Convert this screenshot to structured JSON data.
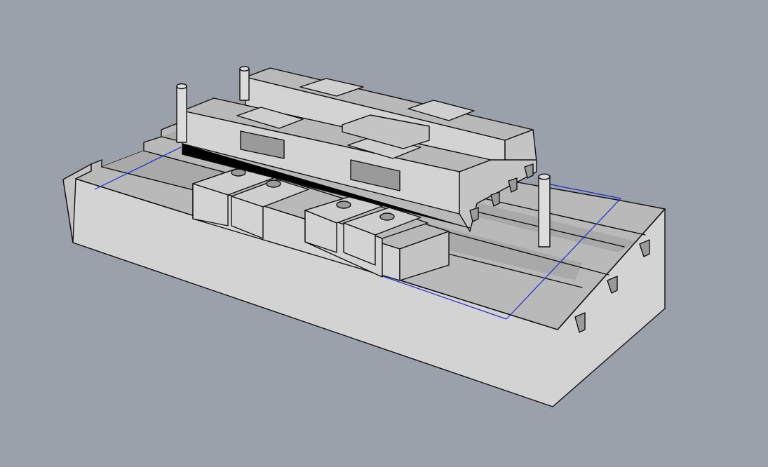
{
  "viewport": {
    "background": "#9ba1aa",
    "mode": "shaded-3d-viewport"
  },
  "model": {
    "parts": [
      "t-slot-base-plate",
      "linear-rail-left",
      "linear-rail-right",
      "carriage-blocks",
      "top-saddle-frame",
      "locating-pins"
    ],
    "guide_color": "#1a2fd0"
  }
}
